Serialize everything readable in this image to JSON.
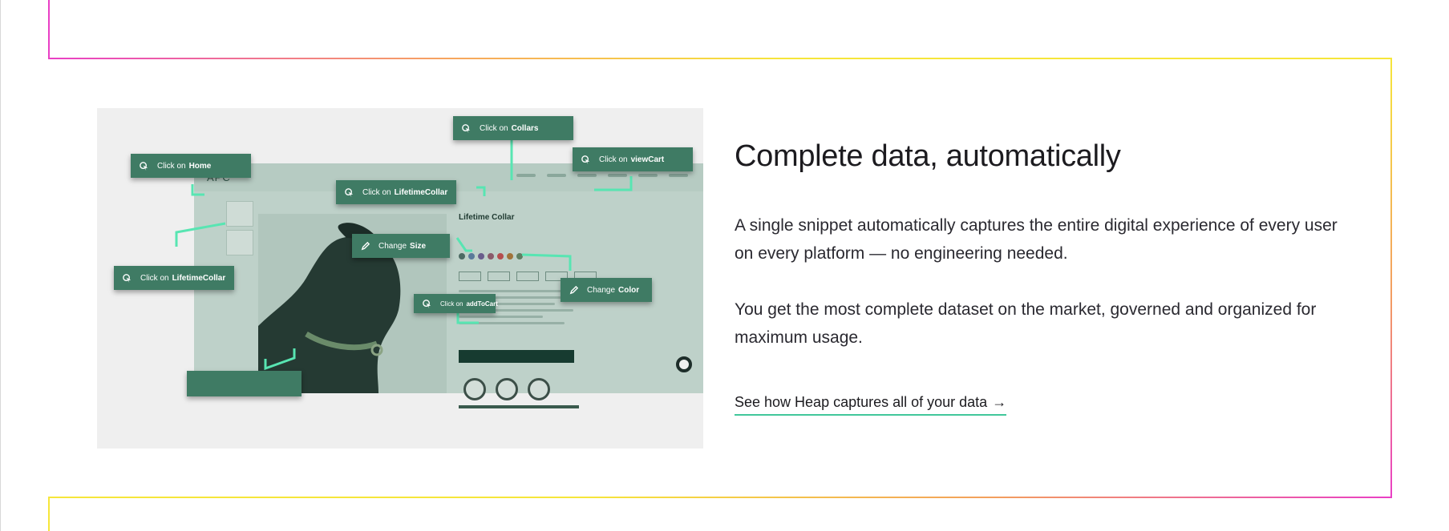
{
  "section": {
    "heading": "Complete data, automatically",
    "paragraphs": [
      "A single snippet automatically captures the entire digital experience of every user on every platform — no engineering needed.",
      "You get the most complete dataset on the market, governed and organized for maximum usage."
    ],
    "cta": {
      "label": "See how Heap captures all of your data",
      "arrow": "→"
    }
  },
  "illustration": {
    "mock_logo": "APC",
    "product_title": "Lifetime Collar",
    "swatch_colors": [
      "#4c6a63",
      "#5a7a9a",
      "#6a5d8c",
      "#8b5a6a",
      "#b54e4e",
      "#a0733a",
      "#5f7f62"
    ],
    "tags": [
      {
        "prefix": "Click on",
        "name": "Collars",
        "icon": "click-icon"
      },
      {
        "prefix": "Click on",
        "name": "Home",
        "icon": "click-icon"
      },
      {
        "prefix": "Click on",
        "name": "viewCart",
        "icon": "click-icon"
      },
      {
        "prefix": "Click on",
        "name": "LifetimeCollar",
        "icon": "click-icon"
      },
      {
        "prefix": "Change",
        "name": "Size",
        "icon": "pencil-icon"
      },
      {
        "prefix": "Click on",
        "name": "LifetimeCollar",
        "icon": "click-icon"
      },
      {
        "prefix": "Change",
        "name": "Color",
        "icon": "pencil-icon"
      },
      {
        "prefix": "Click on",
        "name": "addToCart",
        "icon": "click-icon"
      }
    ]
  },
  "colors": {
    "tag_bg": "#3f7b64",
    "connector": "#58e5b2",
    "cta_underline": "#41c79b",
    "frame_pink": "#e93fc5",
    "frame_yellow": "#f6e63a"
  }
}
